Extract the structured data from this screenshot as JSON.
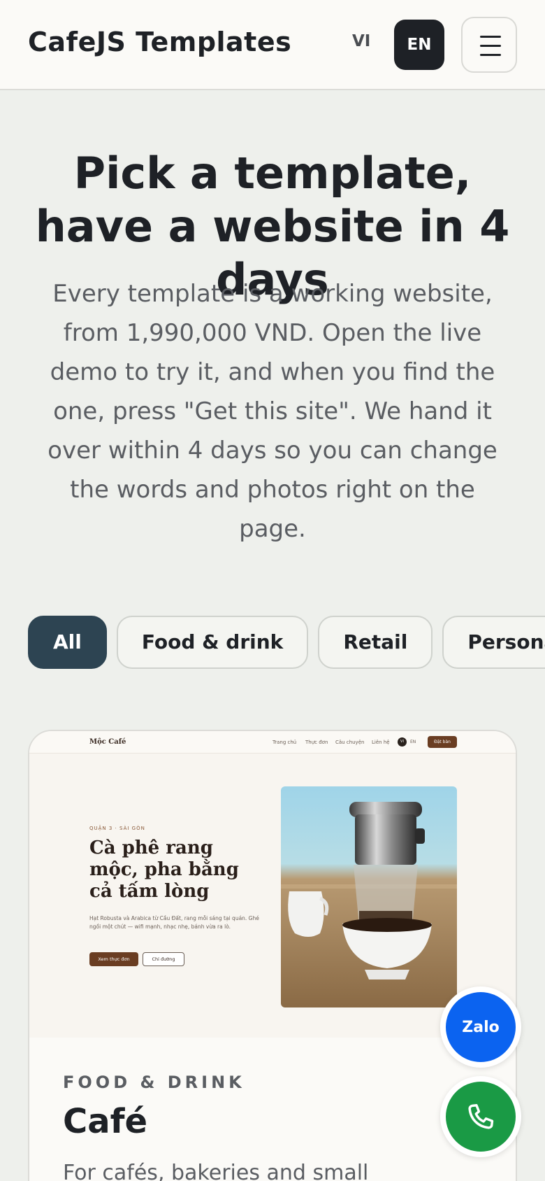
{
  "header": {
    "brand": "CafeJS Templates",
    "lang_vi": "VI",
    "lang_en": "EN",
    "active_lang": "EN",
    "menu_icon": "hamburger-menu-icon"
  },
  "hero": {
    "title": "Pick a template, have a website in 4 days",
    "text": "Every template is a working website, from 1,990,000 VND. Open the live demo to try it, and when you find the one, press \"Get this site\". We hand it over within 4 days so you can change the words and photos right on the page."
  },
  "filters": {
    "items": [
      {
        "label": "All",
        "active": true
      },
      {
        "label": "Food & drink",
        "active": false
      },
      {
        "label": "Retail",
        "active": false
      },
      {
        "label": "Personal & p",
        "active": false
      }
    ]
  },
  "card": {
    "preview": {
      "logo": "Mộc Café",
      "nav": [
        "Trang chủ",
        "Thực đơn",
        "Câu chuyện",
        "Liên hệ"
      ],
      "lang_vi": "VI",
      "lang_en": "EN",
      "book_button": "Đặt bàn",
      "kicker": "QUẬN 3 · SÀI GÒN",
      "heading": "Cà phê rang mộc, pha bằng cả tấm lòng",
      "body": "Hạt Robusta và Arabica từ Cầu Đất, rang mỗi sáng tại quán. Ghé ngồi một chút — wifi mạnh, nhạc nhẹ, bánh vừa ra lò.",
      "primary_button": "Xem thực đơn",
      "secondary_button": "Chỉ đường",
      "photo": "phin-coffee-photo"
    },
    "category": "FOOD & DRINK",
    "title": "Café",
    "description": "For cafés, bakeries and small"
  },
  "fabs": {
    "zalo_label": "Zalo",
    "phone_icon": "phone-icon"
  },
  "colors": {
    "accent_dark": "#1e2126",
    "chip_active": "#2d4452",
    "zalo_blue": "#0b63f0",
    "phone_green": "#1a9a45",
    "coffee_brown": "#6a3d22"
  }
}
